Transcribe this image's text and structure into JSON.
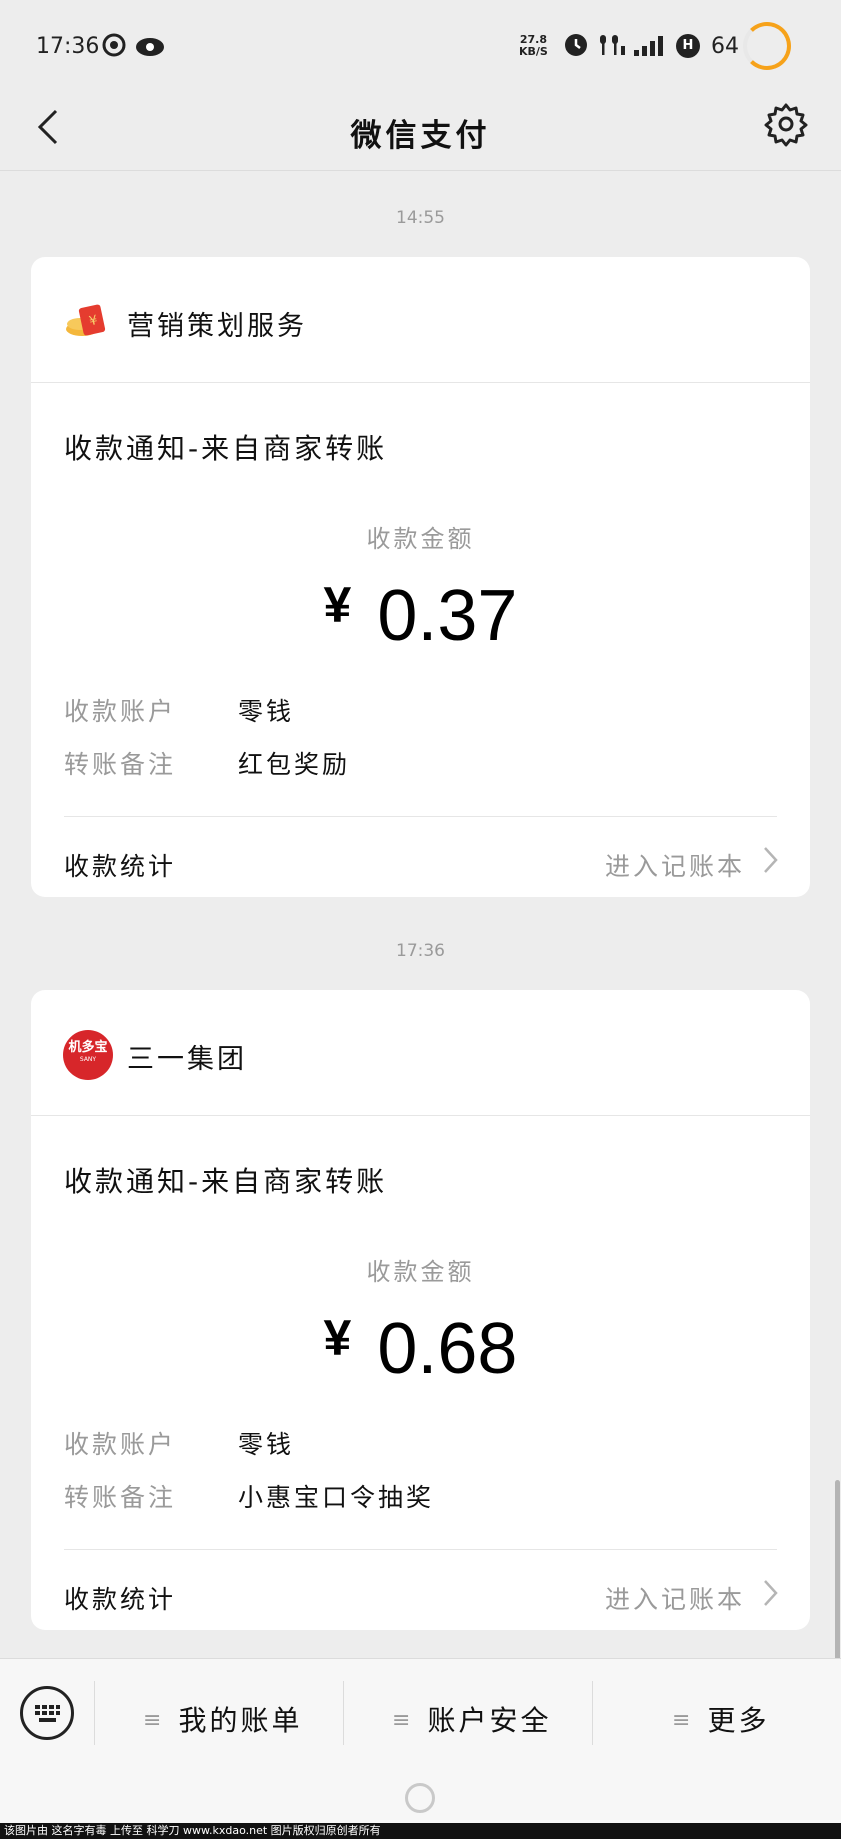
{
  "status_bar": {
    "time": "17:36",
    "net_speed_value": "27.8",
    "net_speed_unit": "KB/S",
    "network_badge": "H",
    "battery": "64"
  },
  "nav": {
    "title": "微信支付"
  },
  "messages": [
    {
      "timestamp": "14:55",
      "source_name": "营销策划服务",
      "title": "收款通知-来自商家转账",
      "amount_label": "收款金额",
      "currency": "¥",
      "amount": "0.37",
      "rows": [
        {
          "label": "收款账户",
          "value": "零钱"
        },
        {
          "label": "转账备注",
          "value": "红包奖励"
        }
      ],
      "stat_label": "收款统计",
      "stat_link": "进入记账本"
    },
    {
      "timestamp": "17:36",
      "source_name": "三一集团",
      "source_logo_text": "机多宝",
      "source_logo_sub": "SANY",
      "title": "收款通知-来自商家转账",
      "amount_label": "收款金额",
      "currency": "¥",
      "amount": "0.68",
      "rows": [
        {
          "label": "收款账户",
          "value": "零钱"
        },
        {
          "label": "转账备注",
          "value": "小惠宝口令抽奖"
        }
      ],
      "stat_label": "收款统计",
      "stat_link": "进入记账本"
    }
  ],
  "bottom_menu": [
    {
      "label": "我的账单"
    },
    {
      "label": "账户安全"
    },
    {
      "label": "更多"
    }
  ],
  "footer": {
    "text": "该图片由 这名字有毒 上传至 科学刀 www.kxdao.net 图片版权归原创者所有"
  },
  "colors": {
    "background": "#ededed",
    "card": "#ffffff",
    "muted_text": "#9a9a9a",
    "battery_ring": "#f6a21a",
    "logo_red": "#d7262a",
    "redpacket_red": "#e53c2f",
    "redpacket_gold": "#f4b73b"
  },
  "icons": [
    "back-icon",
    "gear-icon",
    "red-packet-icon",
    "company-logo-icon",
    "chevron-right-icon",
    "keyboard-icon",
    "menu-icon",
    "home-indicator-icon"
  ]
}
